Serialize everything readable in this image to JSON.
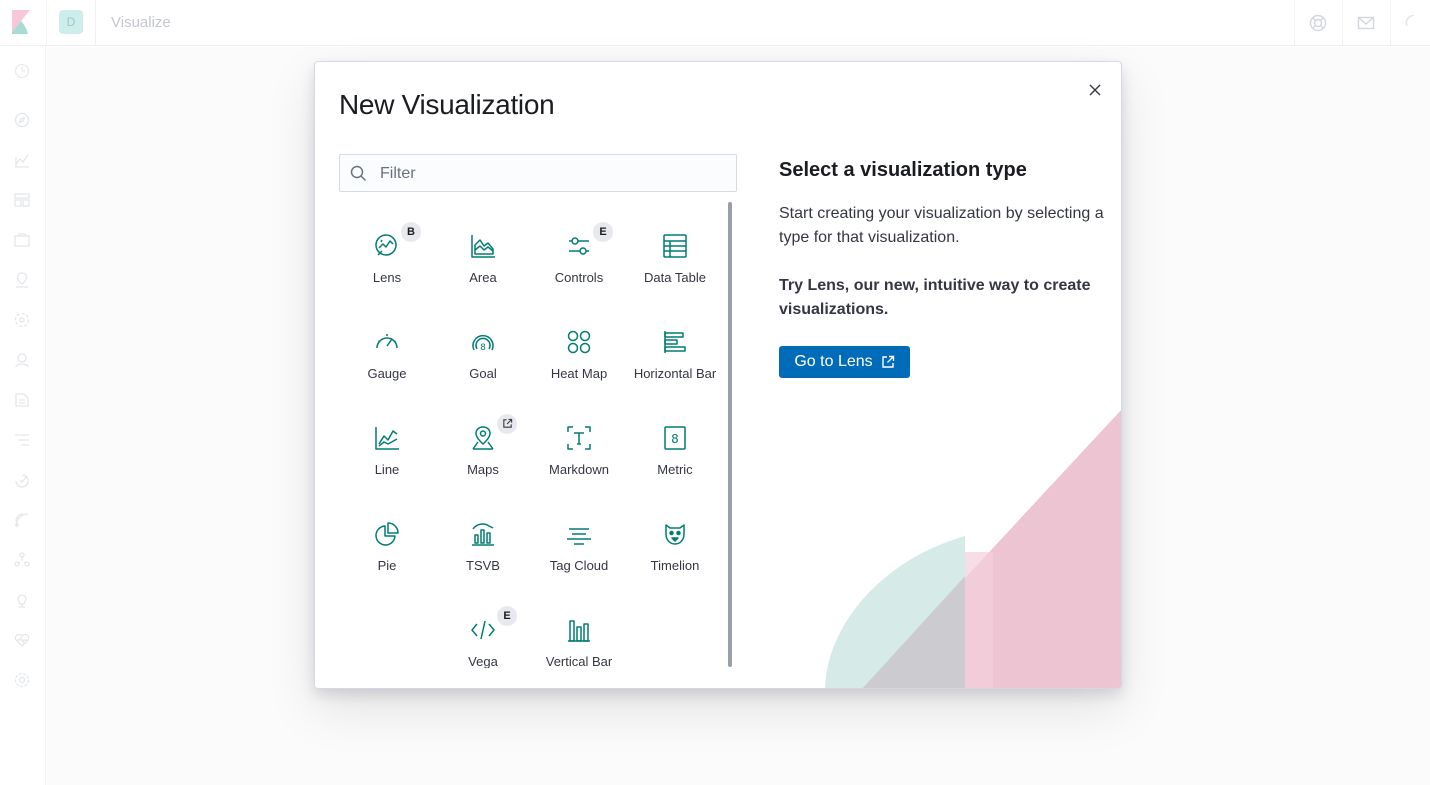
{
  "app": {
    "title": "Visualize",
    "space_initial": "D",
    "colors": {
      "accent": "#006bb8",
      "icon_teal": "#017d73",
      "badge_bg": "#e7e9ee"
    }
  },
  "modal": {
    "title": "New Visualization",
    "close_icon": "cross-icon",
    "search": {
      "placeholder": "Filter",
      "value": ""
    },
    "types": [
      {
        "label": "Lens",
        "icon": "lens-icon",
        "badge": "B"
      },
      {
        "label": "Area",
        "icon": "area-chart-icon",
        "badge": ""
      },
      {
        "label": "Controls",
        "icon": "controls-icon",
        "badge": "E"
      },
      {
        "label": "Data Table",
        "icon": "data-table-icon",
        "badge": ""
      },
      {
        "label": "Gauge",
        "icon": "gauge-icon",
        "badge": ""
      },
      {
        "label": "Goal",
        "icon": "goal-icon",
        "badge": ""
      },
      {
        "label": "Heat Map",
        "icon": "heat-map-icon",
        "badge": ""
      },
      {
        "label": "Horizontal Bar",
        "icon": "horizontal-bar-icon",
        "badge": ""
      },
      {
        "label": "Line",
        "icon": "line-chart-icon",
        "badge": ""
      },
      {
        "label": "Maps",
        "icon": "maps-icon",
        "badge": "external-link"
      },
      {
        "label": "Markdown",
        "icon": "markdown-icon",
        "badge": ""
      },
      {
        "label": "Metric",
        "icon": "metric-icon",
        "badge": ""
      },
      {
        "label": "Pie",
        "icon": "pie-chart-icon",
        "badge": ""
      },
      {
        "label": "TSVB",
        "icon": "tsvb-icon",
        "badge": ""
      },
      {
        "label": "Tag Cloud",
        "icon": "tag-cloud-icon",
        "badge": ""
      },
      {
        "label": "Timelion",
        "icon": "timelion-icon",
        "badge": ""
      },
      {
        "label": "Vega",
        "icon": "vega-icon",
        "badge": "E"
      },
      {
        "label": "Vertical Bar",
        "icon": "vertical-bar-icon",
        "badge": ""
      }
    ],
    "description": {
      "title": "Select a visualization type",
      "text": "Start creating your visualization by selecting a type for that visualization.",
      "lens_promo": "Try Lens, our new, intuitive way to create visualizations.",
      "lens_button": "Go to Lens"
    }
  }
}
